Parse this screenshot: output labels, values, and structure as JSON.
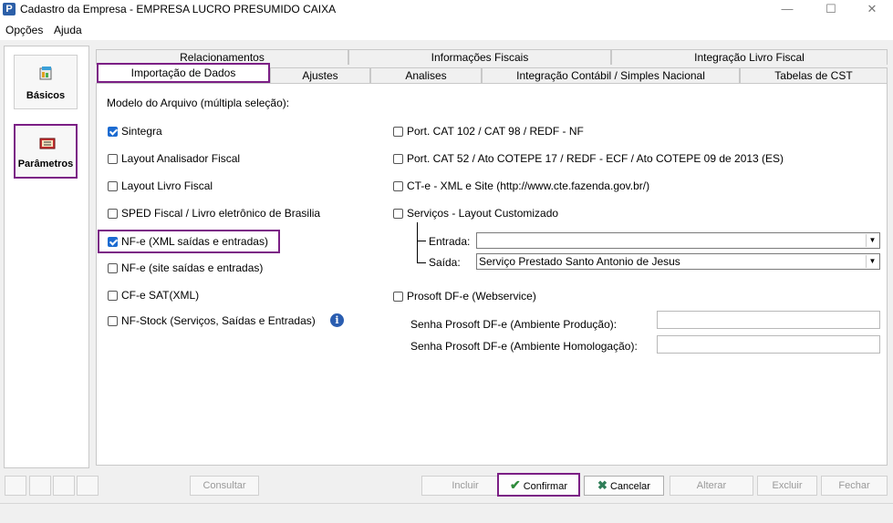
{
  "window": {
    "title": "Cadastro da Empresa - EMPRESA LUCRO PRESUMIDO CAIXA",
    "icon_label": "P",
    "minimize_glyph": "—",
    "maximize_glyph": "☐",
    "close_glyph": "✕"
  },
  "menu": {
    "items": [
      "Opções",
      "Ajuda"
    ]
  },
  "sidebar": {
    "items": [
      {
        "label": "Básicos",
        "icon": "basics-icon"
      },
      {
        "label": "Parâmetros",
        "icon": "parameters-icon"
      }
    ]
  },
  "tabs": {
    "row1": [
      "Relacionamentos",
      "Informações Fiscais",
      "Integração Livro Fiscal"
    ],
    "row2": [
      "Importação de Dados",
      "Ajustes",
      "Analises",
      "Integração Contábil / Simples Nacional",
      "Tabelas de CST"
    ],
    "active": "Importação de Dados"
  },
  "panel": {
    "section_label": "Modelo do Arquivo (múltipla seleção):",
    "left_options": [
      {
        "label": "Sintegra",
        "checked": true
      },
      {
        "label": "Layout Analisador Fiscal",
        "checked": false
      },
      {
        "label": "Layout Livro Fiscal",
        "checked": false
      },
      {
        "label": "SPED Fiscal / Livro eletrônico de Brasilia",
        "checked": false
      },
      {
        "label": "NF-e (XML saídas e entradas)",
        "checked": true
      },
      {
        "label": "NF-e (site saídas e entradas)",
        "checked": false
      },
      {
        "label": "CF-e SAT(XML)",
        "checked": false
      },
      {
        "label": "NF-Stock (Serviços, Saídas e Entradas)",
        "checked": false
      }
    ],
    "info_glyph": "i",
    "right_options": [
      {
        "label": "Port. CAT 102 / CAT 98 / REDF - NF",
        "checked": false
      },
      {
        "label": "Port. CAT 52 / Ato COTEPE 17 / REDF - ECF / Ato COTEPE 09 de 2013 (ES)",
        "checked": false
      },
      {
        "label": "CT-e - XML e Site (http://www.cte.fazenda.gov.br/)",
        "checked": false
      },
      {
        "label": "Serviços - Layout Customizado",
        "checked": false
      }
    ],
    "entrada_label": "Entrada:",
    "entrada_value": "",
    "saida_label": "Saída:",
    "saida_value": "Serviço Prestado Santo Antonio de Jesus",
    "combo_arrow": "▼",
    "prosoft_label": "Prosoft DF-e (Webservice)",
    "prosoft_checked": false,
    "senha_producao_label": "Senha Prosoft DF-e (Ambiente Produção):",
    "senha_homologacao_label": "Senha Prosoft DF-e (Ambiente Homologação):"
  },
  "buttons": {
    "consultar": "Consultar",
    "incluir": "Incluir",
    "confirmar": "Confirmar",
    "cancelar": "Cancelar",
    "alterar": "Alterar",
    "excluir": "Excluir",
    "fechar": "Fechar"
  },
  "colors": {
    "highlight": "#7b1f85",
    "checkbox_checked": "#1c6bd1",
    "confirm_icon": "#2e8b3a",
    "cancel_icon": "#2e7d57",
    "info_icon": "#2a5db0"
  }
}
